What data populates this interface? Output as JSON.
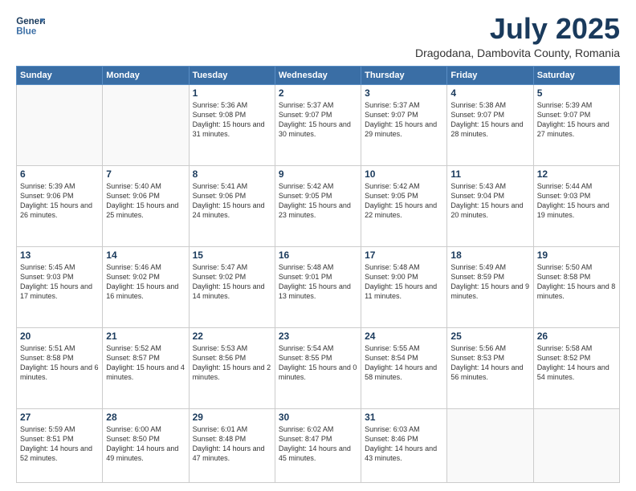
{
  "header": {
    "logo_general": "General",
    "logo_blue": "Blue",
    "month_year": "July 2025",
    "location": "Dragodana, Dambovita County, Romania"
  },
  "weekdays": [
    "Sunday",
    "Monday",
    "Tuesday",
    "Wednesday",
    "Thursday",
    "Friday",
    "Saturday"
  ],
  "weeks": [
    [
      {
        "day": "",
        "content": ""
      },
      {
        "day": "",
        "content": ""
      },
      {
        "day": "1",
        "content": "Sunrise: 5:36 AM\nSunset: 9:08 PM\nDaylight: 15 hours\nand 31 minutes."
      },
      {
        "day": "2",
        "content": "Sunrise: 5:37 AM\nSunset: 9:07 PM\nDaylight: 15 hours\nand 30 minutes."
      },
      {
        "day": "3",
        "content": "Sunrise: 5:37 AM\nSunset: 9:07 PM\nDaylight: 15 hours\nand 29 minutes."
      },
      {
        "day": "4",
        "content": "Sunrise: 5:38 AM\nSunset: 9:07 PM\nDaylight: 15 hours\nand 28 minutes."
      },
      {
        "day": "5",
        "content": "Sunrise: 5:39 AM\nSunset: 9:07 PM\nDaylight: 15 hours\nand 27 minutes."
      }
    ],
    [
      {
        "day": "6",
        "content": "Sunrise: 5:39 AM\nSunset: 9:06 PM\nDaylight: 15 hours\nand 26 minutes."
      },
      {
        "day": "7",
        "content": "Sunrise: 5:40 AM\nSunset: 9:06 PM\nDaylight: 15 hours\nand 25 minutes."
      },
      {
        "day": "8",
        "content": "Sunrise: 5:41 AM\nSunset: 9:06 PM\nDaylight: 15 hours\nand 24 minutes."
      },
      {
        "day": "9",
        "content": "Sunrise: 5:42 AM\nSunset: 9:05 PM\nDaylight: 15 hours\nand 23 minutes."
      },
      {
        "day": "10",
        "content": "Sunrise: 5:42 AM\nSunset: 9:05 PM\nDaylight: 15 hours\nand 22 minutes."
      },
      {
        "day": "11",
        "content": "Sunrise: 5:43 AM\nSunset: 9:04 PM\nDaylight: 15 hours\nand 20 minutes."
      },
      {
        "day": "12",
        "content": "Sunrise: 5:44 AM\nSunset: 9:03 PM\nDaylight: 15 hours\nand 19 minutes."
      }
    ],
    [
      {
        "day": "13",
        "content": "Sunrise: 5:45 AM\nSunset: 9:03 PM\nDaylight: 15 hours\nand 17 minutes."
      },
      {
        "day": "14",
        "content": "Sunrise: 5:46 AM\nSunset: 9:02 PM\nDaylight: 15 hours\nand 16 minutes."
      },
      {
        "day": "15",
        "content": "Sunrise: 5:47 AM\nSunset: 9:02 PM\nDaylight: 15 hours\nand 14 minutes."
      },
      {
        "day": "16",
        "content": "Sunrise: 5:48 AM\nSunset: 9:01 PM\nDaylight: 15 hours\nand 13 minutes."
      },
      {
        "day": "17",
        "content": "Sunrise: 5:48 AM\nSunset: 9:00 PM\nDaylight: 15 hours\nand 11 minutes."
      },
      {
        "day": "18",
        "content": "Sunrise: 5:49 AM\nSunset: 8:59 PM\nDaylight: 15 hours\nand 9 minutes."
      },
      {
        "day": "19",
        "content": "Sunrise: 5:50 AM\nSunset: 8:58 PM\nDaylight: 15 hours\nand 8 minutes."
      }
    ],
    [
      {
        "day": "20",
        "content": "Sunrise: 5:51 AM\nSunset: 8:58 PM\nDaylight: 15 hours\nand 6 minutes."
      },
      {
        "day": "21",
        "content": "Sunrise: 5:52 AM\nSunset: 8:57 PM\nDaylight: 15 hours\nand 4 minutes."
      },
      {
        "day": "22",
        "content": "Sunrise: 5:53 AM\nSunset: 8:56 PM\nDaylight: 15 hours\nand 2 minutes."
      },
      {
        "day": "23",
        "content": "Sunrise: 5:54 AM\nSunset: 8:55 PM\nDaylight: 15 hours\nand 0 minutes."
      },
      {
        "day": "24",
        "content": "Sunrise: 5:55 AM\nSunset: 8:54 PM\nDaylight: 14 hours\nand 58 minutes."
      },
      {
        "day": "25",
        "content": "Sunrise: 5:56 AM\nSunset: 8:53 PM\nDaylight: 14 hours\nand 56 minutes."
      },
      {
        "day": "26",
        "content": "Sunrise: 5:58 AM\nSunset: 8:52 PM\nDaylight: 14 hours\nand 54 minutes."
      }
    ],
    [
      {
        "day": "27",
        "content": "Sunrise: 5:59 AM\nSunset: 8:51 PM\nDaylight: 14 hours\nand 52 minutes."
      },
      {
        "day": "28",
        "content": "Sunrise: 6:00 AM\nSunset: 8:50 PM\nDaylight: 14 hours\nand 49 minutes."
      },
      {
        "day": "29",
        "content": "Sunrise: 6:01 AM\nSunset: 8:48 PM\nDaylight: 14 hours\nand 47 minutes."
      },
      {
        "day": "30",
        "content": "Sunrise: 6:02 AM\nSunset: 8:47 PM\nDaylight: 14 hours\nand 45 minutes."
      },
      {
        "day": "31",
        "content": "Sunrise: 6:03 AM\nSunset: 8:46 PM\nDaylight: 14 hours\nand 43 minutes."
      },
      {
        "day": "",
        "content": ""
      },
      {
        "day": "",
        "content": ""
      }
    ]
  ]
}
